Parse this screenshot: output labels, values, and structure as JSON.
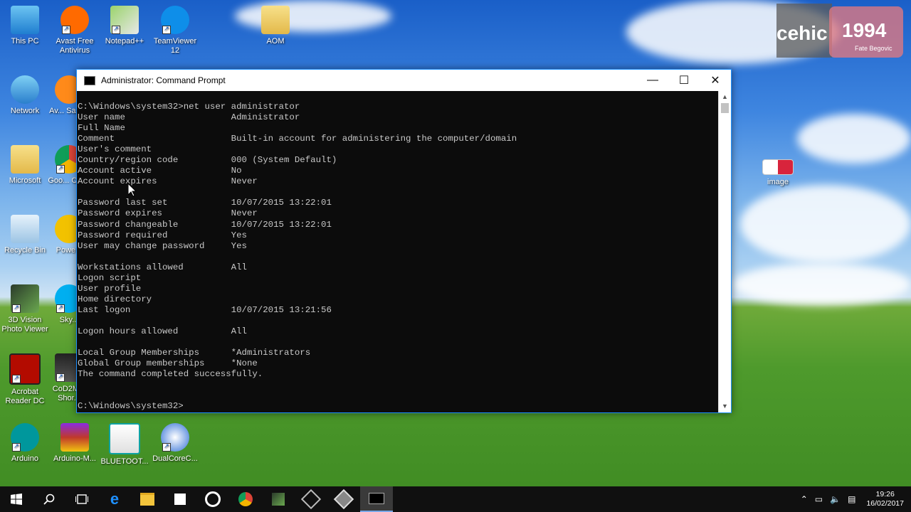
{
  "desktop": {
    "icons": [
      {
        "label": "This PC"
      },
      {
        "label": "Avast Free Antivirus"
      },
      {
        "label": "Notepad++"
      },
      {
        "label": "TeamViewer 12"
      },
      {
        "label": "AOM"
      },
      {
        "label": "Network"
      },
      {
        "label": "Av... Safe..."
      },
      {
        "label": "Microsoft"
      },
      {
        "label": "Goo... Chr..."
      },
      {
        "label": "Recycle Bin"
      },
      {
        "label": "Powe..."
      },
      {
        "label": "3D Vision Photo Viewer"
      },
      {
        "label": "Sky..."
      },
      {
        "label": "Acrobat Reader DC"
      },
      {
        "label": "CoD2M... Shor..."
      },
      {
        "label": "Arduino"
      },
      {
        "label": "Arduino-M..."
      },
      {
        "label": "BLUETOOT..."
      },
      {
        "label": "DualCoreC..."
      },
      {
        "label": "image"
      }
    ]
  },
  "watermark": {
    "left_text": "cehic",
    "right_text": "1994",
    "sub_text": "Fate Begovic"
  },
  "window": {
    "title": "Administrator: Command Prompt",
    "minimize": "—",
    "maximize": "☐",
    "close": "✕"
  },
  "console": {
    "text": "C:\\Windows\\system32>net user administrator\nUser name                    Administrator\nFull Name\nComment                      Built-in account for administering the computer/domain\nUser's comment\nCountry/region code          000 (System Default)\nAccount active               No\nAccount expires              Never\n\nPassword last set            10/07/2015 13:22:01\nPassword expires             Never\nPassword changeable          10/07/2015 13:22:01\nPassword required            Yes\nUser may change password     Yes\n\nWorkstations allowed         All\nLogon script\nUser profile\nHome directory\nLast logon                   10/07/2015 13:21:56\n\nLogon hours allowed          All\n\nLocal Group Memberships      *Administrators\nGlobal Group memberships     *None\nThe command completed successfully.\n\n\nC:\\Windows\\system32>"
  },
  "taskbar": {
    "time": "19:26",
    "date": "16/02/2017"
  },
  "colors": {
    "accent": "#1e90ff",
    "taskbar": "#101010",
    "console_bg": "#0c0c0c",
    "console_fg": "#c8c8c8"
  }
}
